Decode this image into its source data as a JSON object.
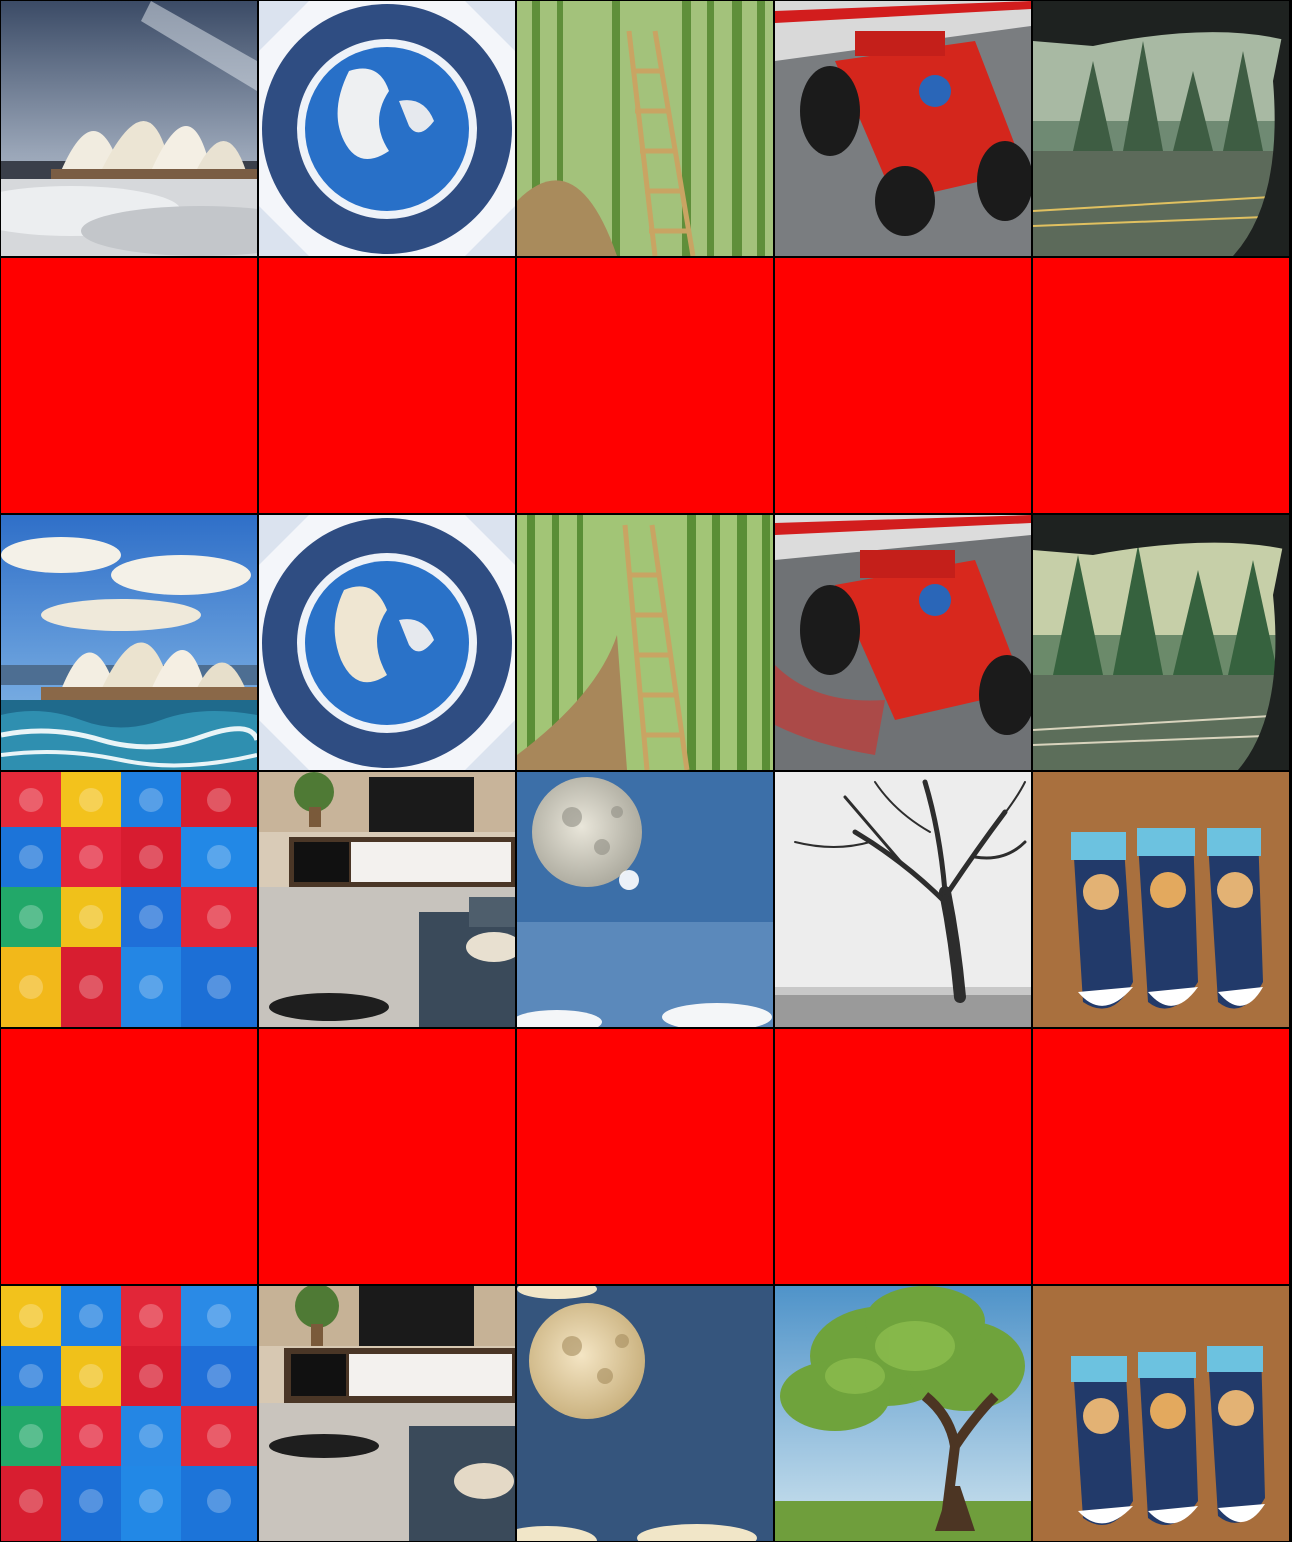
{
  "grid": {
    "rows": 6,
    "columns": 5,
    "placeholder_color": "#ff0000",
    "cells": [
      {
        "row": 1,
        "col": 1,
        "subject": "opera-house-foggy"
      },
      {
        "row": 1,
        "col": 2,
        "subject": "earth-globe-ornate-frame"
      },
      {
        "row": 1,
        "col": 3,
        "subject": "bamboo-forest-ladder"
      },
      {
        "row": 1,
        "col": 4,
        "subject": "red-race-car"
      },
      {
        "row": 1,
        "col": 5,
        "subject": "forest-road-through-windshield"
      },
      {
        "row": 2,
        "col": 1,
        "subject": "red-placeholder"
      },
      {
        "row": 2,
        "col": 2,
        "subject": "red-placeholder"
      },
      {
        "row": 2,
        "col": 3,
        "subject": "red-placeholder"
      },
      {
        "row": 2,
        "col": 4,
        "subject": "red-placeholder"
      },
      {
        "row": 2,
        "col": 5,
        "subject": "red-placeholder"
      },
      {
        "row": 3,
        "col": 1,
        "subject": "opera-house-ocean-waves"
      },
      {
        "row": 3,
        "col": 2,
        "subject": "earth-globe-ornate-frame"
      },
      {
        "row": 3,
        "col": 3,
        "subject": "bamboo-forest-ladder"
      },
      {
        "row": 3,
        "col": 4,
        "subject": "red-race-car"
      },
      {
        "row": 3,
        "col": 5,
        "subject": "forest-road-through-windshield"
      },
      {
        "row": 4,
        "col": 1,
        "subject": "toy-bricks"
      },
      {
        "row": 4,
        "col": 2,
        "subject": "living-room"
      },
      {
        "row": 4,
        "col": 3,
        "subject": "moon-blue-sky"
      },
      {
        "row": 4,
        "col": 4,
        "subject": "bare-tree-monochrome"
      },
      {
        "row": 4,
        "col": 5,
        "subject": "cat-socks"
      },
      {
        "row": 5,
        "col": 1,
        "subject": "red-placeholder"
      },
      {
        "row": 5,
        "col": 2,
        "subject": "red-placeholder"
      },
      {
        "row": 5,
        "col": 3,
        "subject": "red-placeholder"
      },
      {
        "row": 5,
        "col": 4,
        "subject": "red-placeholder"
      },
      {
        "row": 5,
        "col": 5,
        "subject": "red-placeholder"
      },
      {
        "row": 6,
        "col": 1,
        "subject": "toy-bricks"
      },
      {
        "row": 6,
        "col": 2,
        "subject": "living-room"
      },
      {
        "row": 6,
        "col": 3,
        "subject": "moon-night-sky-clouds"
      },
      {
        "row": 6,
        "col": 4,
        "subject": "green-tree-landscape"
      },
      {
        "row": 6,
        "col": 5,
        "subject": "cat-socks"
      }
    ]
  }
}
